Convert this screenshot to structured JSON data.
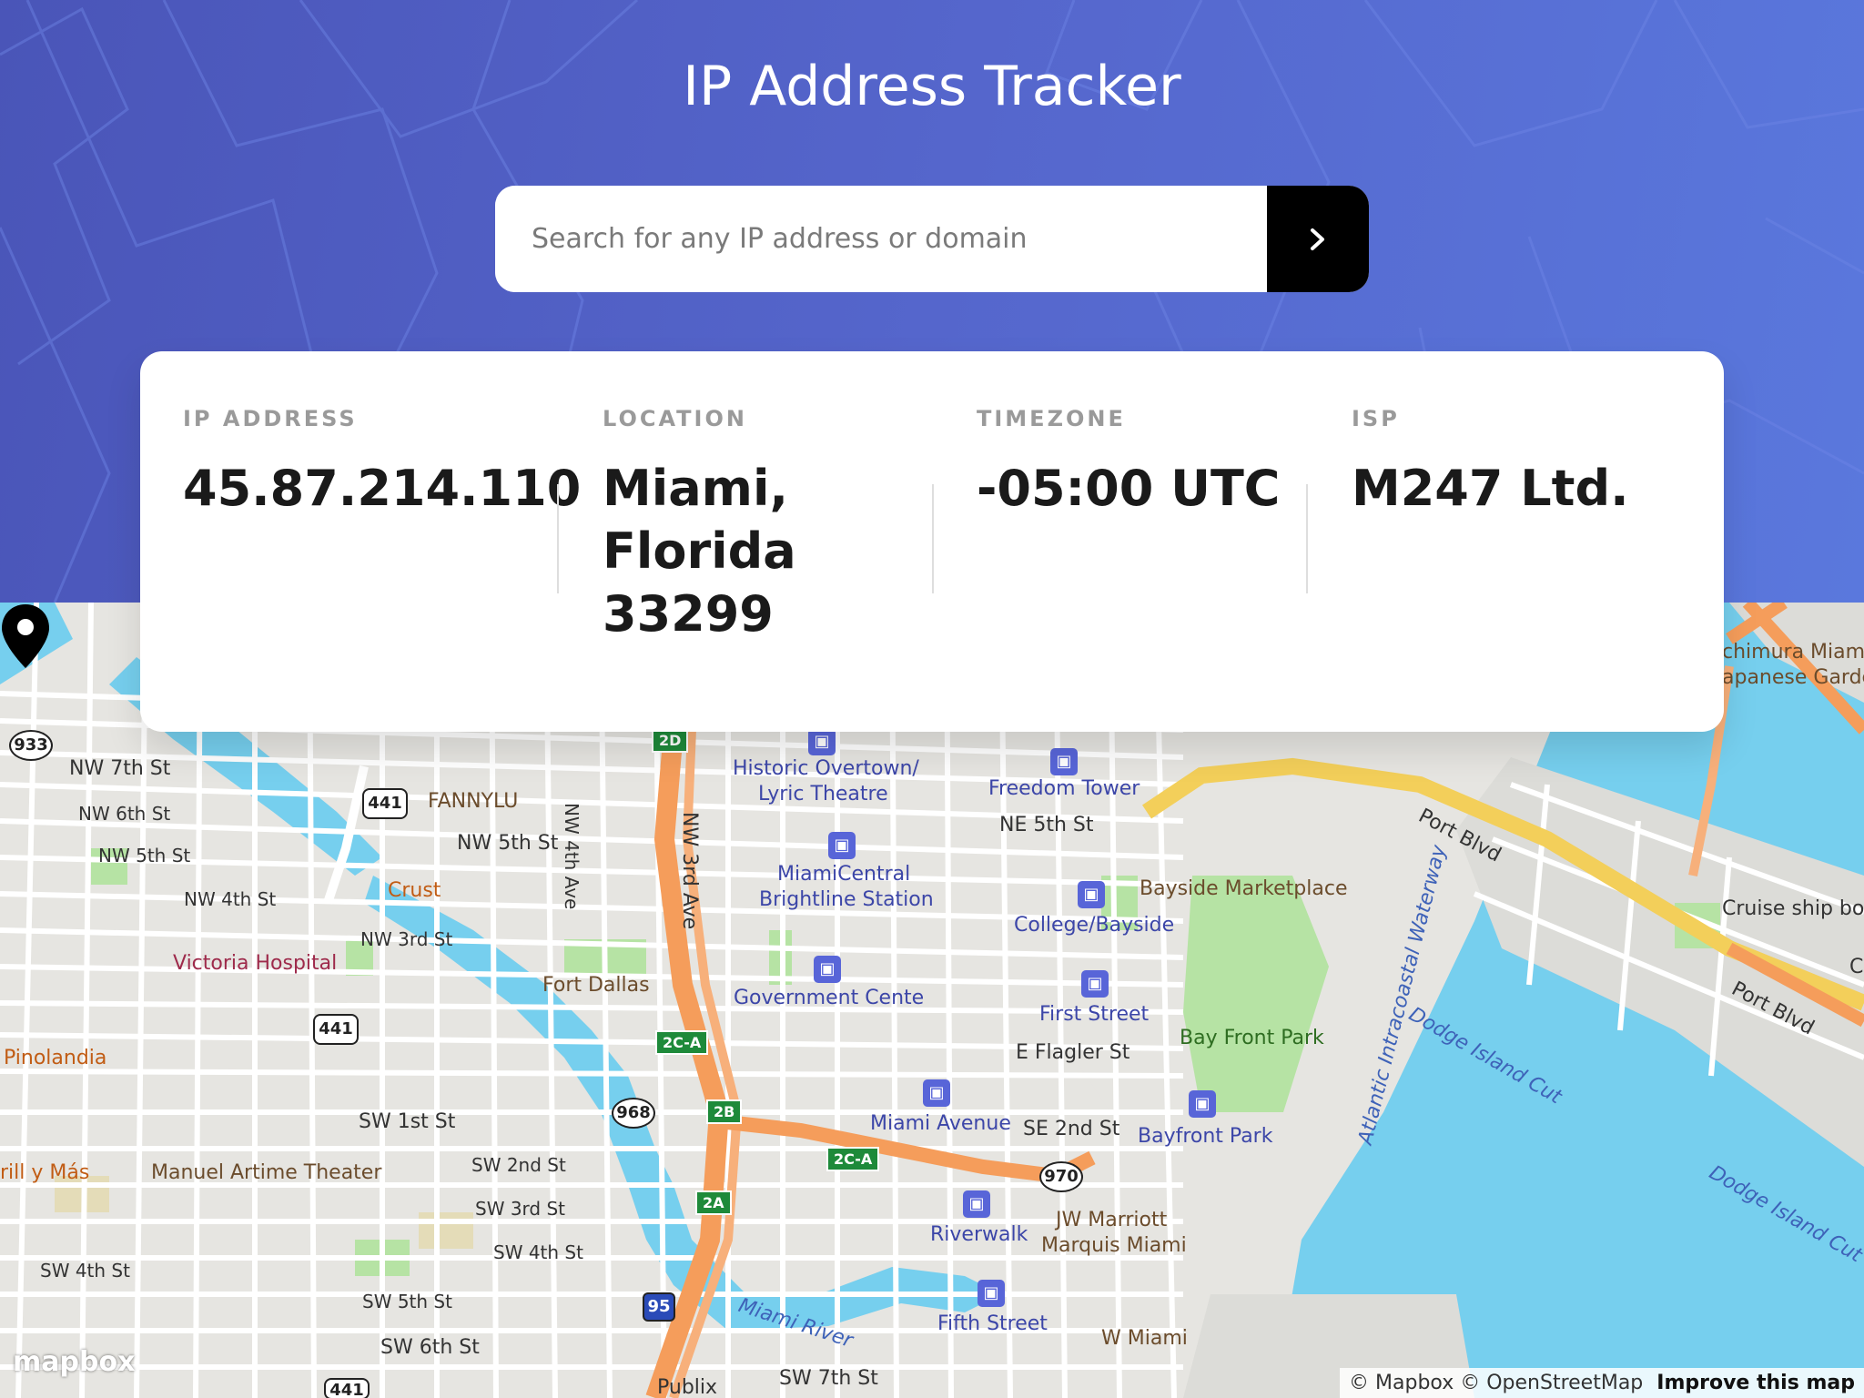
{
  "header": {
    "title": "IP Address Tracker",
    "search": {
      "placeholder": "Search for any IP address or domain",
      "value": "",
      "button_icon": "chevron-right-icon"
    },
    "colors": {
      "header_start": "#4a55b8",
      "header_end": "#5a78dd",
      "button": "#000000"
    }
  },
  "info": {
    "ip_label": "IP ADDRESS",
    "ip_value": "45.87.214.110",
    "location_label": "LOCATION",
    "location_line1": "Miami,",
    "location_line2": "Florida",
    "location_line3": "33299",
    "timezone_label": "TIMEZONE",
    "timezone_value": "-05:00 UTC",
    "isp_label": "ISP",
    "isp_value": "M247 Ltd."
  },
  "map": {
    "labels": {
      "nw7": "NW 7th St",
      "nw6": "NW 6th St",
      "nw5a": "NW 5th St",
      "nw4": "NW 4th St",
      "nw3": "NW 3rd St",
      "nw5b": "NW 5th St",
      "fannylu": "FANNYLU",
      "crust": "Crust",
      "victoria": "Victoria Hospital",
      "pinolandia": "Pinolandia",
      "fortdallas": "Fort Dallas",
      "nw4ave": "NW 4th Ave",
      "nw3ave": "NW 3rd Ave",
      "overtown1": "Historic Overtown/",
      "overtown2": "Lyric Theatre",
      "freedom": "Freedom Tower",
      "ne5": "NE 5th St",
      "miamicentral1": "MiamiCentral",
      "miamicentral2": "Brightline Station",
      "bayside_mkt": "Bayside Marketplace",
      "college": "College/Bayside",
      "govcenter": "Government Cente",
      "firststreet": "First Street",
      "eflagler": "E Flagler St",
      "bayfront": "Bay Front Park",
      "miamiave": "Miami Avenue",
      "se2": "SE 2nd St",
      "bayfrontpark": "Bayfront Park",
      "sw1": "SW 1st St",
      "sw2": "SW 2nd St",
      "sw3": "SW 3rd St",
      "sw4a": "SW 4th St",
      "sw4b": "SW 4th St",
      "sw5": "SW 5th St",
      "sw6": "SW 6th St",
      "sw7": "SW 7th St",
      "manuel": "Manuel Artime Theater",
      "grill": "rill y Más",
      "riverwalk": "Riverwalk",
      "jw1": "JW Marriott",
      "jw2": "Marquis Miami",
      "fifth": "Fifth Street",
      "wmiami": "W Miami",
      "miamiriver": "Miami River",
      "publix": "Publix",
      "portblvd1": "Port Blvd",
      "portblvd2": "Port Blvd",
      "intracoastal": "Atlantic Intracoastal Waterway",
      "dodge1": "Dodge Island Cut",
      "dodge2": "Dodge Island Cut",
      "cruise": "Cruise ship boa",
      "ichimura1": "chimura Miami",
      "ichimura2": "apanese Garde",
      "c_edge": "C"
    },
    "shields": {
      "s933": "933",
      "s441a": "441",
      "s441b": "441",
      "s441c": "441",
      "s968": "968",
      "s970": "970",
      "s95": "95"
    },
    "exits": {
      "e2d": "2D",
      "e2ca1": "2C-A",
      "e2b": "2B",
      "e2ca2": "2C-A",
      "e2a": "2A"
    },
    "logo": "mapbox",
    "attribution": {
      "mapbox": "© Mapbox",
      "osm": "© OpenStreetMap",
      "improve": "Improve this map"
    }
  }
}
